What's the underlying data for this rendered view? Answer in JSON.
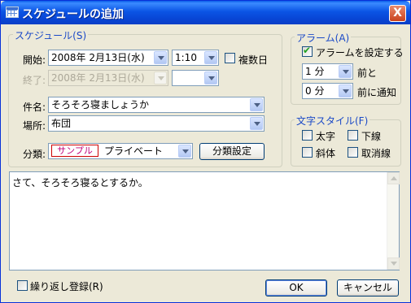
{
  "window": {
    "title": "スケジュールの追加",
    "close_label": "X"
  },
  "schedule_group": {
    "legend": "スケジュール(S)",
    "start_label": "開始:",
    "start_date": "2008年  2月13日(水)",
    "start_time": "1:10",
    "multi_day_label": "複数日",
    "multi_day_checked": false,
    "end_label": "終了:",
    "end_date": "2008年  2月13日(水)",
    "end_time": "",
    "subject_label": "件名:",
    "subject_value": "そろそろ寝ましょうか",
    "place_label": "場所:",
    "place_value": "布団",
    "category_label": "分類:",
    "category_sample": "サンプル",
    "category_value": "プライベート",
    "category_settings_button": "分類設定"
  },
  "alarm_group": {
    "legend": "アラーム(A)",
    "enable_label": "アラームを設定する",
    "enable_checked": true,
    "before_value": "1 分",
    "before_label": "前と",
    "notify_value": "0 分",
    "notify_label": "前に通知"
  },
  "text_style_group": {
    "legend": "文字スタイル(F)",
    "bold_label": "太字",
    "underline_label": "下線",
    "italic_label": "斜体",
    "strike_label": "取消線"
  },
  "memo": {
    "text": "さて、そろそろ寝るとするか。"
  },
  "footer": {
    "repeat_label": "繰り返し登録(R)",
    "ok_label": "OK",
    "cancel_label": "キャンセル"
  }
}
